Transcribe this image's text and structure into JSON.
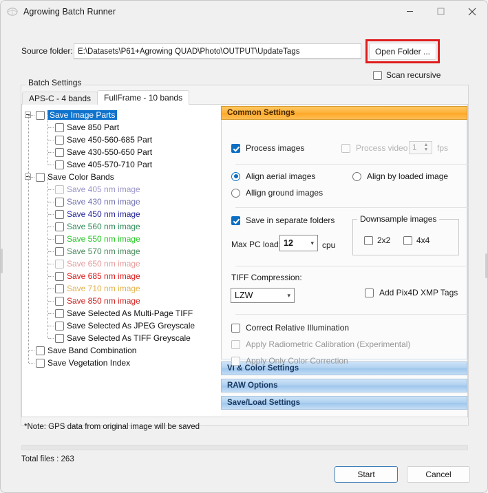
{
  "window": {
    "title": "Agrowing Batch Runner",
    "icon": "leaf-logo-icon",
    "minimize": "minimize-icon",
    "maximize": "maximize-icon",
    "close": "close-icon"
  },
  "source": {
    "label": "Source folder:",
    "value": "E:\\Datasets\\P61+Agrowing QUAD\\Photo\\OUTPUT\\UpdateTags",
    "placeholder": "",
    "open_folder_label": "Open Folder ...",
    "highlight_color": "#e01b1b",
    "scan_recursive_label": "Scan recursive",
    "scan_recursive_checked": false
  },
  "batch_settings": {
    "group_title": "Batch Settings",
    "tabs": [
      {
        "label": "APS-C - 4 bands",
        "active": false
      },
      {
        "label": "FullFrame - 10 bands",
        "active": true
      }
    ],
    "tree": [
      {
        "label": "Save Image Parts",
        "level": 0,
        "checked": false,
        "selected": true,
        "expander": "collapse-icon",
        "color": "#111111"
      },
      {
        "label": "Save 850 Part",
        "level": 1,
        "checked": false,
        "selected": false,
        "color": "#111111"
      },
      {
        "label": "Save 450-560-685 Part",
        "level": 1,
        "checked": false,
        "selected": false,
        "color": "#111111"
      },
      {
        "label": "Save 430-550-650 Part",
        "level": 1,
        "checked": false,
        "selected": false,
        "color": "#111111"
      },
      {
        "label": "Save 405-570-710 Part",
        "level": 1,
        "checked": false,
        "selected": false,
        "color": "#111111"
      },
      {
        "label": "Save Color Bands",
        "level": 0,
        "checked": false,
        "selected": false,
        "expander": "collapse-icon",
        "color": "#111111"
      },
      {
        "label": "Save 405 nm image",
        "level": 1,
        "checked": false,
        "selected": false,
        "color": "#9a96c8",
        "disabled": true
      },
      {
        "label": "Save 430 nm image",
        "level": 1,
        "checked": false,
        "selected": false,
        "color": "#6f6fb0"
      },
      {
        "label": "Save 450 nm image",
        "level": 1,
        "checked": false,
        "selected": false,
        "color": "#1f1f96"
      },
      {
        "label": "Save 560 nm image",
        "level": 1,
        "checked": false,
        "selected": false,
        "color": "#2e8b57"
      },
      {
        "label": "Save 550 nm image",
        "level": 1,
        "checked": false,
        "selected": false,
        "color": "#22c522"
      },
      {
        "label": "Save 570 nm image",
        "level": 1,
        "checked": false,
        "selected": false,
        "color": "#4a8a5e"
      },
      {
        "label": "Save 650 nm image",
        "level": 1,
        "checked": false,
        "selected": false,
        "color": "#e39a9a",
        "disabled": true
      },
      {
        "label": "Save 685 nm image",
        "level": 1,
        "checked": false,
        "selected": false,
        "color": "#d81818"
      },
      {
        "label": "Save 710 nm image",
        "level": 1,
        "checked": false,
        "selected": false,
        "color": "#e2b24a"
      },
      {
        "label": "Save 850 nm image",
        "level": 1,
        "checked": false,
        "selected": false,
        "color": "#d12020"
      },
      {
        "label": "Save Selected As Multi-Page TIFF",
        "level": 1,
        "checked": false,
        "selected": false,
        "color": "#111111"
      },
      {
        "label": "Save Selected As JPEG Greyscale",
        "level": 1,
        "checked": false,
        "selected": false,
        "color": "#111111"
      },
      {
        "label": "Save Selected As TIFF Greyscale",
        "level": 1,
        "checked": false,
        "selected": false,
        "color": "#111111"
      },
      {
        "label": "Save Band Combination",
        "level": 0,
        "checked": false,
        "selected": false,
        "color": "#111111"
      },
      {
        "label": "Save Vegetation Index",
        "level": 0,
        "checked": false,
        "selected": false,
        "color": "#111111"
      }
    ]
  },
  "common_settings": {
    "header": "Common Settings",
    "process_images": {
      "label": "Process images",
      "checked": true
    },
    "process_video": {
      "label": "Process video",
      "checked": false,
      "disabled": true
    },
    "fps": {
      "value": "1",
      "unit": "fps"
    },
    "align_aerial": {
      "label": "Align aerial images",
      "selected": true
    },
    "align_ground": {
      "label": "Allign ground images",
      "selected": false
    },
    "align_loaded": {
      "label": "Align by loaded image",
      "selected": false
    },
    "save_separate_folders": {
      "label": "Save in separate folders",
      "checked": true
    },
    "max_pc_load": {
      "label": "Max PC load:",
      "value": "12",
      "unit": "cpu"
    },
    "downsample": {
      "legend": "Downsample images",
      "options": [
        {
          "label": "2x2",
          "checked": false
        },
        {
          "label": "4x4",
          "checked": false
        }
      ]
    },
    "tiff_compression": {
      "label": "TIFF Compression:",
      "value": "LZW"
    },
    "add_xmp_tags": {
      "label": "Add Pix4D XMP Tags",
      "checked": false
    },
    "correct_relative_illumination": {
      "label": "Correct Relative Illumination",
      "checked": false
    },
    "apply_radiometric_calibration": {
      "label": "Apply Radiometric Calibration (Experimental)",
      "checked": false,
      "disabled": true
    },
    "apply_only_color_correction": {
      "label": "Apply Only Color Correction",
      "checked": false,
      "disabled": true
    }
  },
  "collapsed_sections": [
    {
      "label": "VI & Color Settings"
    },
    {
      "label": "RAW Options"
    },
    {
      "label": "Save/Load Settings"
    }
  ],
  "footer": {
    "note": "*Note: GPS data from original image will be saved",
    "progress_percent": 0,
    "total_files": "Total files : 263",
    "start_label": "Start",
    "cancel_label": "Cancel"
  }
}
